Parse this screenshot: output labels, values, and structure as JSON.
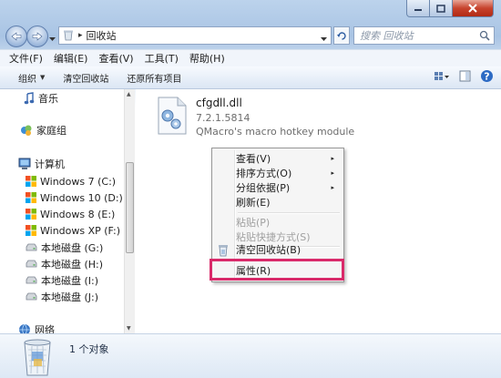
{
  "address": {
    "path": "回收站",
    "separator": "▸"
  },
  "search": {
    "placeholder": "搜索 回收站"
  },
  "menubar": [
    {
      "label": "文件(F)"
    },
    {
      "label": "编辑(E)"
    },
    {
      "label": "查看(V)"
    },
    {
      "label": "工具(T)"
    },
    {
      "label": "帮助(H)"
    }
  ],
  "toolbar": {
    "organize": "组织",
    "organize_arrow": "▼",
    "empty": "清空回收站",
    "restore": "还原所有项目"
  },
  "nav": {
    "music": "音乐",
    "homegroup": "家庭组",
    "computer": "计算机",
    "drives": [
      {
        "label": "Windows 7 (C:)"
      },
      {
        "label": "Windows 10 (D:)"
      },
      {
        "label": "Windows 8 (E:)"
      },
      {
        "label": "Windows XP (F:)"
      },
      {
        "label": "本地磁盘 (G:)"
      },
      {
        "label": "本地磁盘 (H:)"
      },
      {
        "label": "本地磁盘 (I:)"
      },
      {
        "label": "本地磁盘 (J:)"
      }
    ],
    "network": "网络"
  },
  "file": {
    "name": "cfgdll.dll",
    "version": "7.2.1.5814",
    "description": "QMacro's macro hotkey module"
  },
  "context_menu": {
    "view": "查看(V)",
    "sort": "排序方式(O)",
    "group": "分组依据(P)",
    "refresh": "刷新(E)",
    "paste": "粘贴(P)",
    "paste_shortcut": "粘贴快捷方式(S)",
    "empty_bin": "清空回收站(B)",
    "properties": "属性(R)",
    "submenu_arrow": "▸"
  },
  "status": {
    "count": "1 个对象"
  },
  "colors": {
    "highlight": "#d92a6a",
    "close_button": "#c7432d",
    "accent": "#2a5aa0"
  }
}
